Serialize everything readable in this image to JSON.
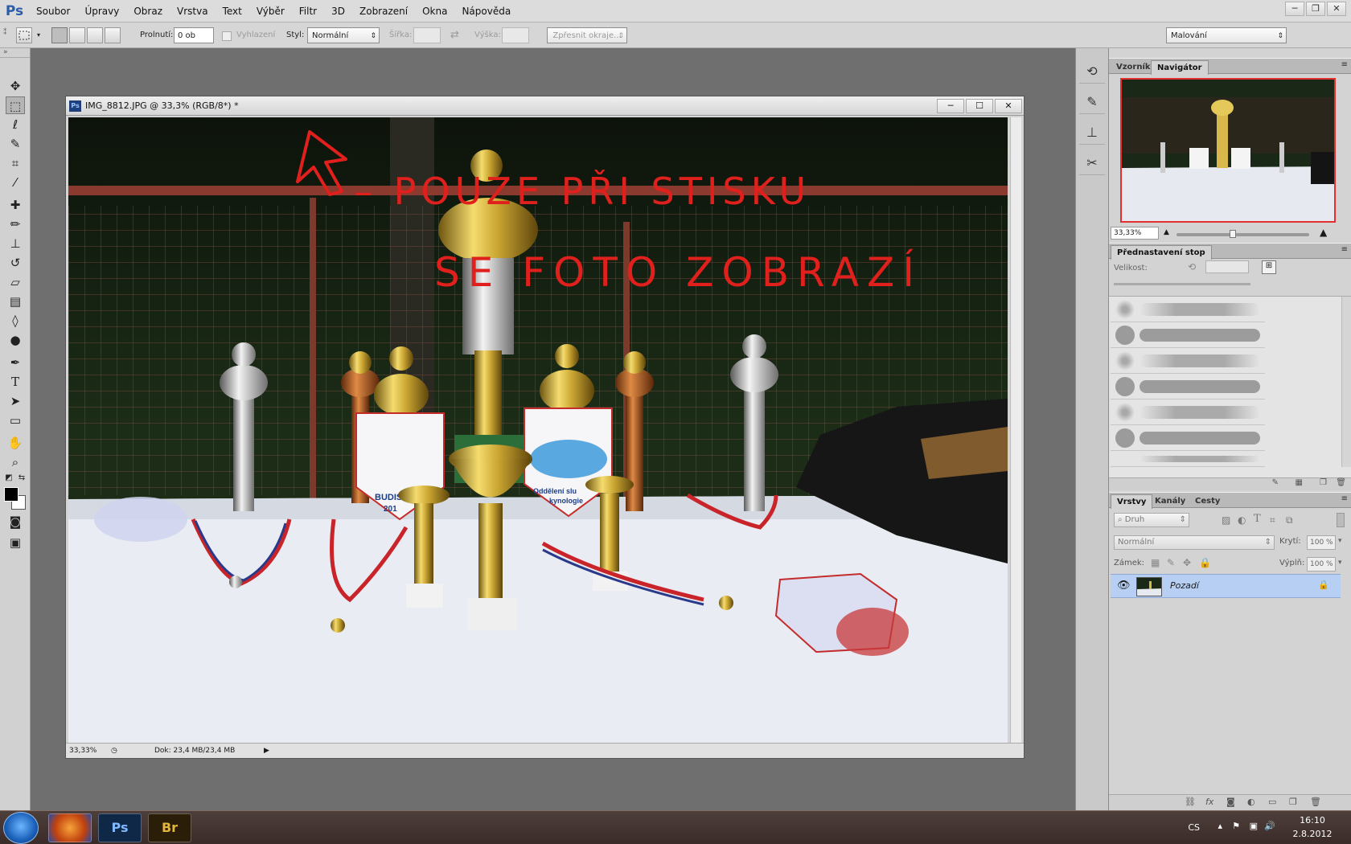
{
  "app": {
    "logo": "Ps",
    "menus": [
      "Soubor",
      "Úpravy",
      "Obraz",
      "Vrstva",
      "Text",
      "Výběr",
      "Filtr",
      "3D",
      "Zobrazení",
      "Okna",
      "Nápověda"
    ],
    "window_controls": [
      "─",
      "❐",
      "✕"
    ]
  },
  "options_bar": {
    "feather_label": "Prolnutí:",
    "feather_value": "0 ob",
    "antialias_label": "Vyhlazení",
    "style_label": "Styl:",
    "style_value": "Normální",
    "width_label": "Šířka:",
    "height_label": "Výška:",
    "refine_button": "Zpřesnit okraje...",
    "workspace_value": "Malování"
  },
  "document": {
    "title": "IMG_8812.JPG @ 33,3% (RGB/8*) *",
    "icon_text": "Ps",
    "zoom": "33,33%",
    "doc_size": "Dok: 23,4 MB/23,4 MB",
    "annotation_line1": "– POUZE PŘI STISKU",
    "annotation_line2": "SE FOTO ZOBRAZÍ",
    "pennant_left_text": "BUDIS",
    "pennant_left_year": "201",
    "pennant_right_text": "Oddělení slu",
    "pennant_right_text2": "kynologie",
    "accent_red": "#e0201c"
  },
  "panels": {
    "top_tabs": [
      "Vzorník",
      "Navigátor"
    ],
    "active_top_tab": "Navigátor",
    "navigator_zoom": "33,33%",
    "brush_presets_tab": "Přednastavení stop",
    "brush_size_label": "Velikost:",
    "layer_tabs": [
      "Vrstvy",
      "Kanály",
      "Cesty"
    ],
    "layer_filter": "Druh",
    "blend_mode": "Normální",
    "opacity_label": "Krytí:",
    "opacity_value": "100 %",
    "lock_label": "Zámek:",
    "fill_label": "Výplň:",
    "fill_value": "100 %",
    "layers": [
      {
        "name": "Pozadí",
        "locked": true,
        "visible": true
      }
    ]
  },
  "taskbar": {
    "apps": [
      "Firefox",
      "Ps",
      "Br"
    ],
    "language": "CS",
    "time": "16:10",
    "date": "2.8.2012"
  }
}
